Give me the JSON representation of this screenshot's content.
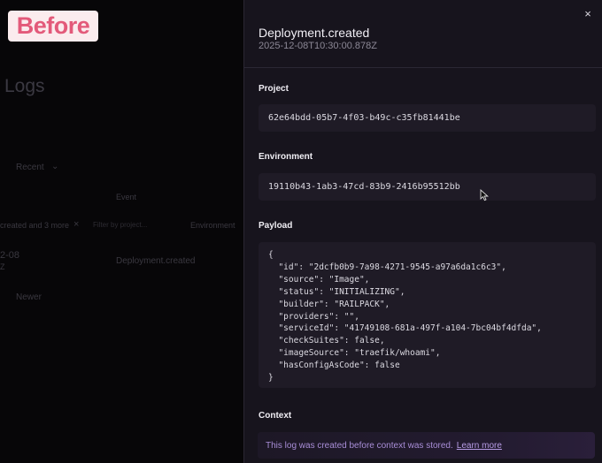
{
  "badge": {
    "label": "Before"
  },
  "background": {
    "title": "Logs",
    "recent_label": "Recent",
    "event_column": "Event",
    "filter_tag": "created and 3 more",
    "filter_placeholder": "Filter by project...",
    "environment_column": "Environment",
    "row": {
      "date": "2-08",
      "date_sub": "Z",
      "event": "Deployment.created"
    },
    "newer_label": "Newer"
  },
  "panel": {
    "title": "Deployment.created",
    "timestamp": "2025-12-08T10:30:00.878Z",
    "close_glyph": "×",
    "project_label": "Project",
    "project_value": "62e64bdd-05b7-4f03-b49c-c35fb81441be",
    "environment_label": "Environment",
    "environment_value": "19110b43-1ab3-47cd-83b9-2416b95512bb",
    "payload_label": "Payload",
    "payload_text": "{\n  \"id\": \"2dcfb0b9-7a98-4271-9545-a97a6da1c6c3\",\n  \"source\": \"Image\",\n  \"status\": \"INITIALIZING\",\n  \"builder\": \"RAILPACK\",\n  \"providers\": \"\",\n  \"serviceId\": \"41749108-681a-497f-a104-7bc04bf4dfda\",\n  \"checkSuites\": false,\n  \"imageSource\": \"traefik/whoami\",\n  \"hasConfigAsCode\": false\n}",
    "context_label": "Context",
    "context_message": "This log was created before context was stored.",
    "context_link": "Learn more"
  },
  "colors": {
    "badge_text": "#e35a7a",
    "badge_bg": "#fbecee",
    "panel_bg": "#17141d",
    "context_accent": "#a98ed8"
  }
}
